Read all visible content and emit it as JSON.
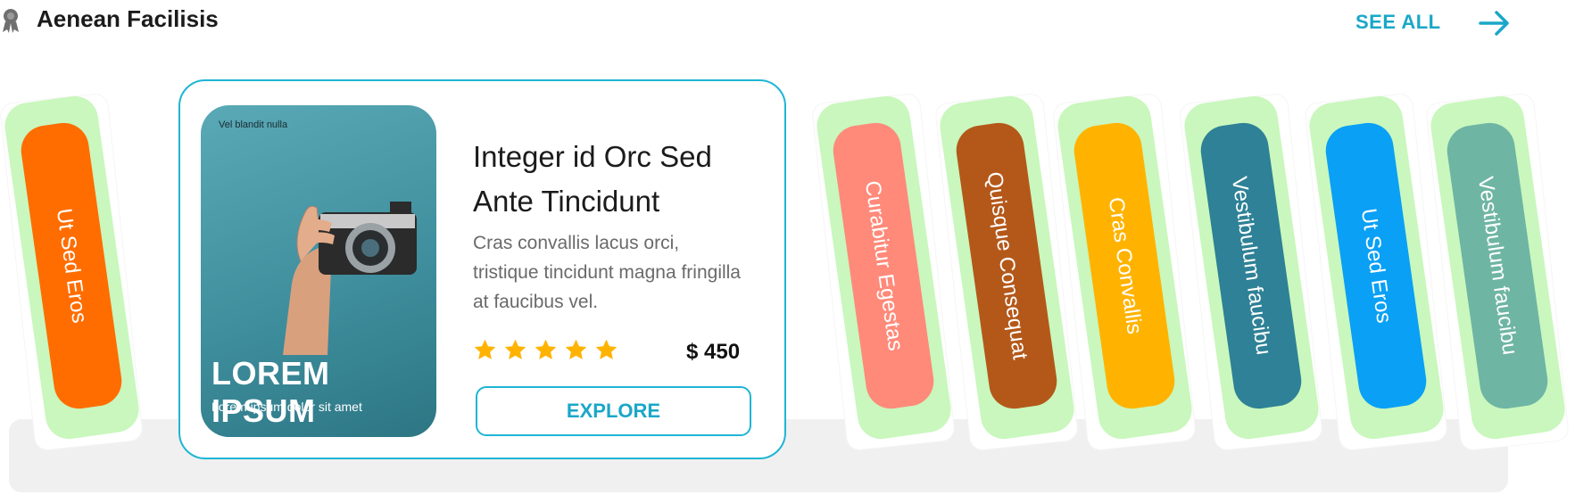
{
  "header": {
    "title": "Aenean Facilisis",
    "see_all": "SEE ALL"
  },
  "featured": {
    "photo_caption": "Vel blandit nulla",
    "photo_title": "LOREM IPSUM",
    "photo_subtitle": "Lorem ipsum dolor sit amet",
    "title": "Integer id Orc Sed Ante Tincidunt",
    "description": "Cras convallis lacus orci, tristique tincidunt magna fringilla at faucibus vel.",
    "rating": 5,
    "price": "$ 450",
    "explore_label": "EXPLORE"
  },
  "tiles": [
    {
      "label": "Ut Sed Eros",
      "color": "#ff6d00"
    },
    {
      "label": "Curabitur Egestas",
      "color": "#ff8a7a"
    },
    {
      "label": "Quisque Consequat",
      "color": "#b4581a"
    },
    {
      "label": "Cras Convallis",
      "color": "#ffb300"
    },
    {
      "label": "Vestibulum faucibu",
      "color": "#2e8196"
    },
    {
      "label": "Ut Sed Eros",
      "color": "#0aa0f5"
    },
    {
      "label": "Vestibulum faucibu",
      "color": "#6fb5a4"
    }
  ],
  "colors": {
    "accent": "#1eb5d4",
    "tile_frame": "#c9f7bd",
    "star": "#ffb300"
  },
  "icons": {
    "award": "award-ribbon-icon",
    "arrow": "arrow-right-icon",
    "star": "star-icon"
  }
}
